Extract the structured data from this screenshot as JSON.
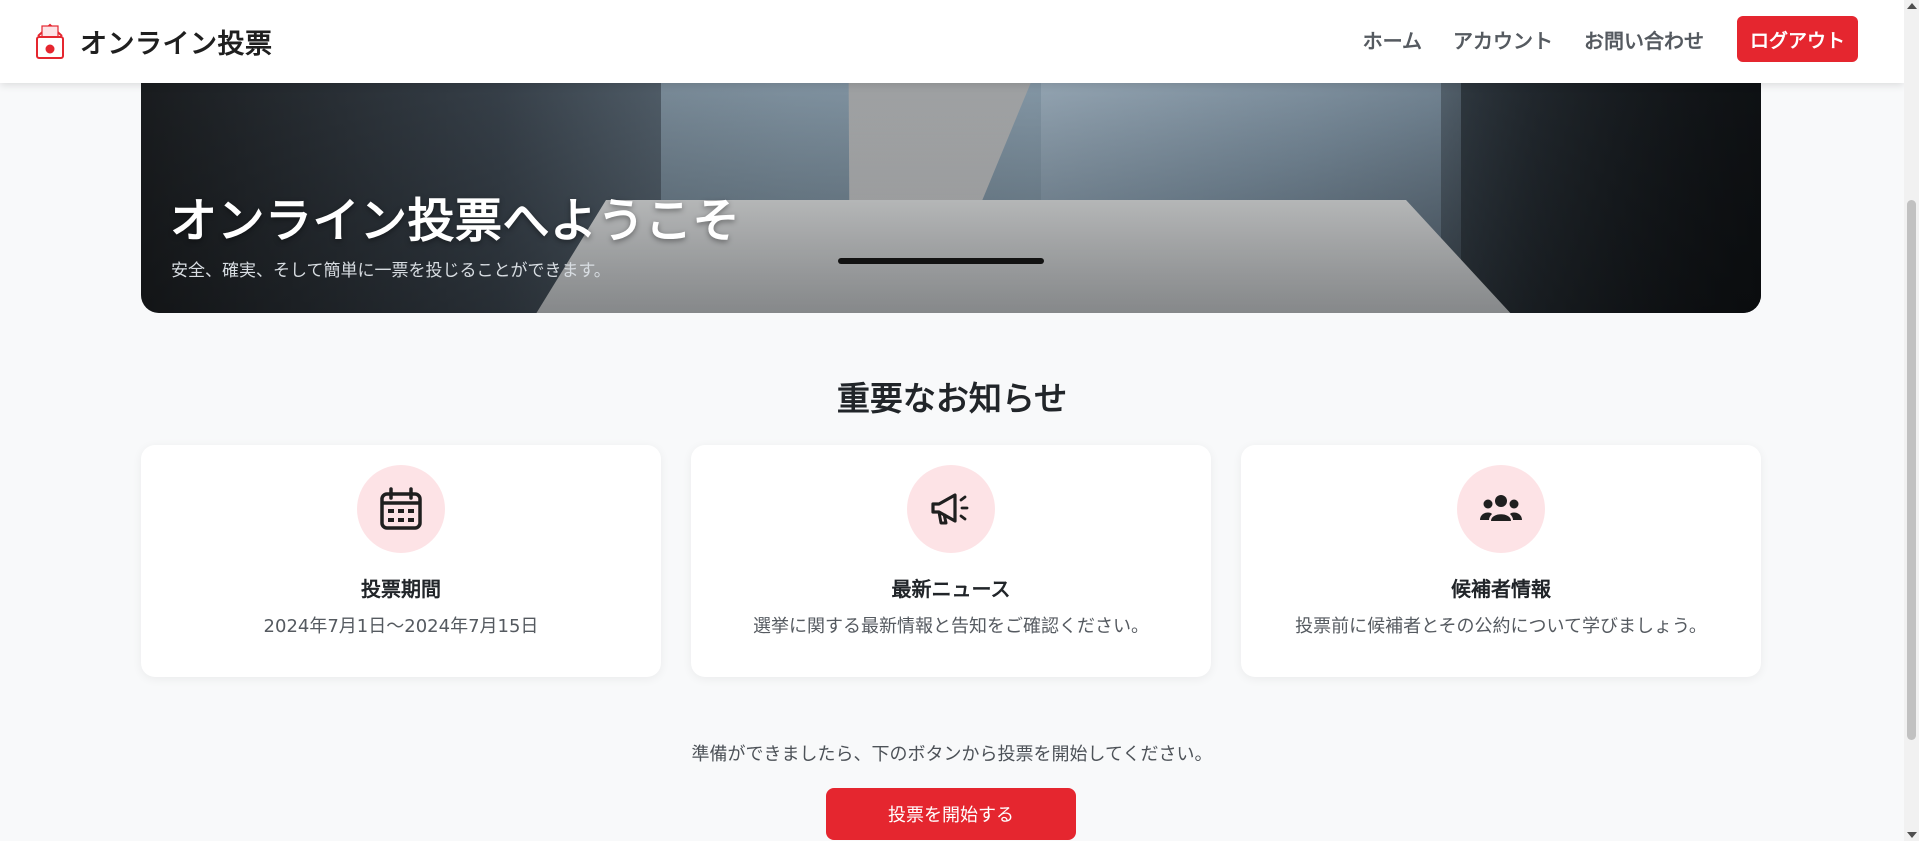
{
  "app": {
    "brand_name": "オンライン投票"
  },
  "nav": {
    "items": [
      {
        "label": "ホーム"
      },
      {
        "label": "アカウント"
      },
      {
        "label": "お問い合わせ"
      }
    ],
    "logout_label": "ログアウト"
  },
  "hero": {
    "title": "オンライン投票へようこそ",
    "subtitle": "安全、確実、そして簡単に一票を投じることができます。"
  },
  "notices": {
    "title": "重要なお知らせ",
    "cards": [
      {
        "icon": "calendar-icon",
        "title": "投票期間",
        "text": "2024年7月1日～2024年7月15日"
      },
      {
        "icon": "megaphone-icon",
        "title": "最新ニュース",
        "text": "選挙に関する最新情報と告知をご確認ください。"
      },
      {
        "icon": "users-icon",
        "title": "候補者情報",
        "text": "投票前に候補者とその公約について学びましょう。"
      }
    ]
  },
  "cta": {
    "text": "準備ができましたら、下のボタンから投票を開始してください。",
    "button_label": "投票を開始する"
  },
  "colors": {
    "accent": "#e5262f",
    "icon_bg": "#fde3e6",
    "page_bg": "#f8f9fa"
  }
}
